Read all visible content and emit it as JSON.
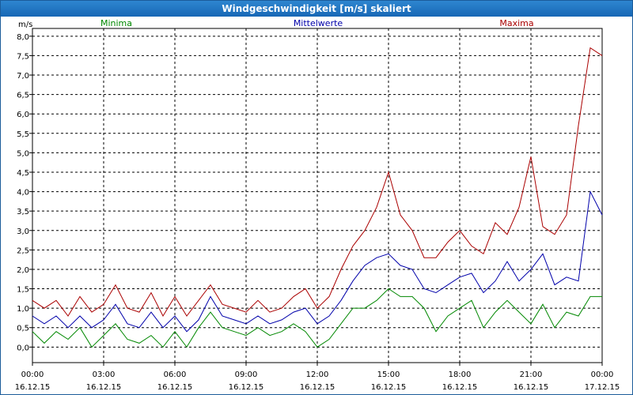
{
  "window": {
    "title": "Windgeschwindigkeit [m/s] skaliert"
  },
  "colors": {
    "min": "#008800",
    "mean": "#0000aa",
    "max": "#aa0000",
    "grid": "#000000"
  },
  "chart_data": {
    "type": "line",
    "title": "Windgeschwindigkeit [m/s] skaliert",
    "ylabel": "m/s",
    "xlabel": "",
    "ylim": [
      -0.4,
      8.2
    ],
    "xlim_hours": [
      0,
      24
    ],
    "grid": true,
    "legend_placement": "top",
    "yticks": [
      "0,0",
      "0,5",
      "1,0",
      "1,5",
      "2,0",
      "2,5",
      "3,0",
      "3,5",
      "4,0",
      "4,5",
      "5,0",
      "5,5",
      "6,0",
      "6,5",
      "7,0",
      "7,5",
      "8,0"
    ],
    "xticks": [
      {
        "time": "00:00",
        "date": "16.12.15"
      },
      {
        "time": "03:00",
        "date": "16.12.15"
      },
      {
        "time": "06:00",
        "date": "16.12.15"
      },
      {
        "time": "09:00",
        "date": "16.12.15"
      },
      {
        "time": "12:00",
        "date": "16.12.15"
      },
      {
        "time": "15:00",
        "date": "16.12.15"
      },
      {
        "time": "18:00",
        "date": "16.12.15"
      },
      {
        "time": "21:00",
        "date": "16.12.15"
      },
      {
        "time": "00:00",
        "date": "17.12.15"
      }
    ],
    "series": [
      {
        "name": "Minima",
        "key": "min",
        "points": [
          [
            0,
            0.4
          ],
          [
            0.5,
            0.1
          ],
          [
            1,
            0.4
          ],
          [
            1.5,
            0.2
          ],
          [
            2,
            0.5
          ],
          [
            2.5,
            0.0
          ],
          [
            3,
            0.3
          ],
          [
            3.5,
            0.6
          ],
          [
            4,
            0.2
          ],
          [
            4.5,
            0.1
          ],
          [
            5,
            0.3
          ],
          [
            5.5,
            0.0
          ],
          [
            6,
            0.4
          ],
          [
            6.5,
            0.0
          ],
          [
            7,
            0.5
          ],
          [
            7.5,
            0.9
          ],
          [
            8,
            0.5
          ],
          [
            8.5,
            0.4
          ],
          [
            9,
            0.3
          ],
          [
            9.5,
            0.5
          ],
          [
            10,
            0.3
          ],
          [
            10.5,
            0.4
          ],
          [
            11,
            0.6
          ],
          [
            11.5,
            0.4
          ],
          [
            12,
            0.0
          ],
          [
            12.5,
            0.2
          ],
          [
            13,
            0.6
          ],
          [
            13.5,
            1.0
          ],
          [
            14,
            1.0
          ],
          [
            14.5,
            1.2
          ],
          [
            15,
            1.5
          ],
          [
            15.5,
            1.3
          ],
          [
            16,
            1.3
          ],
          [
            16.5,
            1.0
          ],
          [
            17,
            0.4
          ],
          [
            17.5,
            0.8
          ],
          [
            18,
            1.0
          ],
          [
            18.5,
            1.2
          ],
          [
            19,
            0.5
          ],
          [
            19.5,
            0.9
          ],
          [
            20,
            1.2
          ],
          [
            20.5,
            0.9
          ],
          [
            21,
            0.6
          ],
          [
            21.5,
            1.1
          ],
          [
            22,
            0.5
          ],
          [
            22.5,
            0.9
          ],
          [
            23,
            0.8
          ],
          [
            23.5,
            1.3
          ],
          [
            24,
            1.3
          ]
        ]
      },
      {
        "name": "Mittelwerte",
        "key": "mean",
        "points": [
          [
            0,
            0.8
          ],
          [
            0.5,
            0.6
          ],
          [
            1,
            0.8
          ],
          [
            1.5,
            0.5
          ],
          [
            2,
            0.8
          ],
          [
            2.5,
            0.5
          ],
          [
            3,
            0.7
          ],
          [
            3.5,
            1.1
          ],
          [
            4,
            0.6
          ],
          [
            4.5,
            0.5
          ],
          [
            5,
            0.9
          ],
          [
            5.5,
            0.5
          ],
          [
            6,
            0.8
          ],
          [
            6.5,
            0.4
          ],
          [
            7,
            0.7
          ],
          [
            7.5,
            1.3
          ],
          [
            8,
            0.8
          ],
          [
            8.5,
            0.7
          ],
          [
            9,
            0.6
          ],
          [
            9.5,
            0.8
          ],
          [
            10,
            0.6
          ],
          [
            10.5,
            0.7
          ],
          [
            11,
            0.9
          ],
          [
            11.5,
            1.0
          ],
          [
            12,
            0.6
          ],
          [
            12.5,
            0.8
          ],
          [
            13,
            1.2
          ],
          [
            13.5,
            1.7
          ],
          [
            14,
            2.1
          ],
          [
            14.5,
            2.3
          ],
          [
            15,
            2.4
          ],
          [
            15.5,
            2.1
          ],
          [
            16,
            2.0
          ],
          [
            16.5,
            1.5
          ],
          [
            17,
            1.4
          ],
          [
            17.5,
            1.6
          ],
          [
            18,
            1.8
          ],
          [
            18.5,
            1.9
          ],
          [
            19,
            1.4
          ],
          [
            19.5,
            1.7
          ],
          [
            20,
            2.2
          ],
          [
            20.5,
            1.7
          ],
          [
            21,
            2.0
          ],
          [
            21.5,
            2.4
          ],
          [
            22,
            1.6
          ],
          [
            22.5,
            1.8
          ],
          [
            23,
            1.7
          ],
          [
            23.5,
            4.0
          ],
          [
            24,
            3.4
          ]
        ]
      },
      {
        "name": "Maxima",
        "key": "max",
        "points": [
          [
            0,
            1.2
          ],
          [
            0.5,
            1.0
          ],
          [
            1,
            1.2
          ],
          [
            1.5,
            0.8
          ],
          [
            2,
            1.3
          ],
          [
            2.5,
            0.9
          ],
          [
            3,
            1.1
          ],
          [
            3.5,
            1.6
          ],
          [
            4,
            1.0
          ],
          [
            4.5,
            0.9
          ],
          [
            5,
            1.4
          ],
          [
            5.5,
            0.8
          ],
          [
            6,
            1.3
          ],
          [
            6.5,
            0.8
          ],
          [
            7,
            1.2
          ],
          [
            7.5,
            1.6
          ],
          [
            8,
            1.1
          ],
          [
            8.5,
            1.0
          ],
          [
            9,
            0.9
          ],
          [
            9.5,
            1.2
          ],
          [
            10,
            0.9
          ],
          [
            10.5,
            1.0
          ],
          [
            11,
            1.3
          ],
          [
            11.5,
            1.5
          ],
          [
            12,
            1.0
          ],
          [
            12.5,
            1.3
          ],
          [
            13,
            2.0
          ],
          [
            13.5,
            2.6
          ],
          [
            14,
            3.0
          ],
          [
            14.5,
            3.6
          ],
          [
            15,
            4.5
          ],
          [
            15.5,
            3.4
          ],
          [
            16,
            3.0
          ],
          [
            16.5,
            2.3
          ],
          [
            17,
            2.3
          ],
          [
            17.5,
            2.7
          ],
          [
            18,
            3.0
          ],
          [
            18.5,
            2.6
          ],
          [
            19,
            2.4
          ],
          [
            19.5,
            3.2
          ],
          [
            20,
            2.9
          ],
          [
            20.5,
            3.6
          ],
          [
            21,
            4.9
          ],
          [
            21.5,
            3.1
          ],
          [
            22,
            2.9
          ],
          [
            22.5,
            3.4
          ],
          [
            23,
            5.7
          ],
          [
            23.5,
            7.7
          ],
          [
            24,
            7.5
          ]
        ]
      }
    ]
  }
}
